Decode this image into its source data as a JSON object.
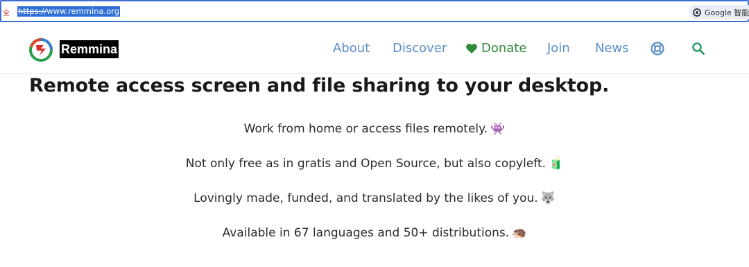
{
  "browser": {
    "left_glyph": "全",
    "url_scheme": "https://",
    "url_rest": "www.remmina.org",
    "google_chip_label": "Google 智能搜"
  },
  "site": {
    "brand": "Remmina",
    "nav": {
      "about": "About",
      "discover": "Discover",
      "donate": "Donate",
      "join": "Join",
      "news": "News"
    },
    "icons": [
      "remmina-logo-icon",
      "heart-icon",
      "lifebuoy-icon",
      "search-icon"
    ],
    "colors": {
      "nav_link": "#5b8fc7",
      "donate": "#2e8b3a",
      "search_icon": "#2e9e6b"
    }
  },
  "main": {
    "headline": "Remote access screen and file sharing to your desktop.",
    "lines": [
      {
        "text": "Work from home or access files remotely.",
        "emoji": "👾"
      },
      {
        "text": "Not only free as in gratis and Open Source, but also copyleft.",
        "emoji": "🧃"
      },
      {
        "text": "Lovingly made, funded, and translated by the likes of you.",
        "emoji": "🐺"
      },
      {
        "text": "Available in 67 languages and 50+ distributions.",
        "emoji": "🦔"
      }
    ]
  }
}
